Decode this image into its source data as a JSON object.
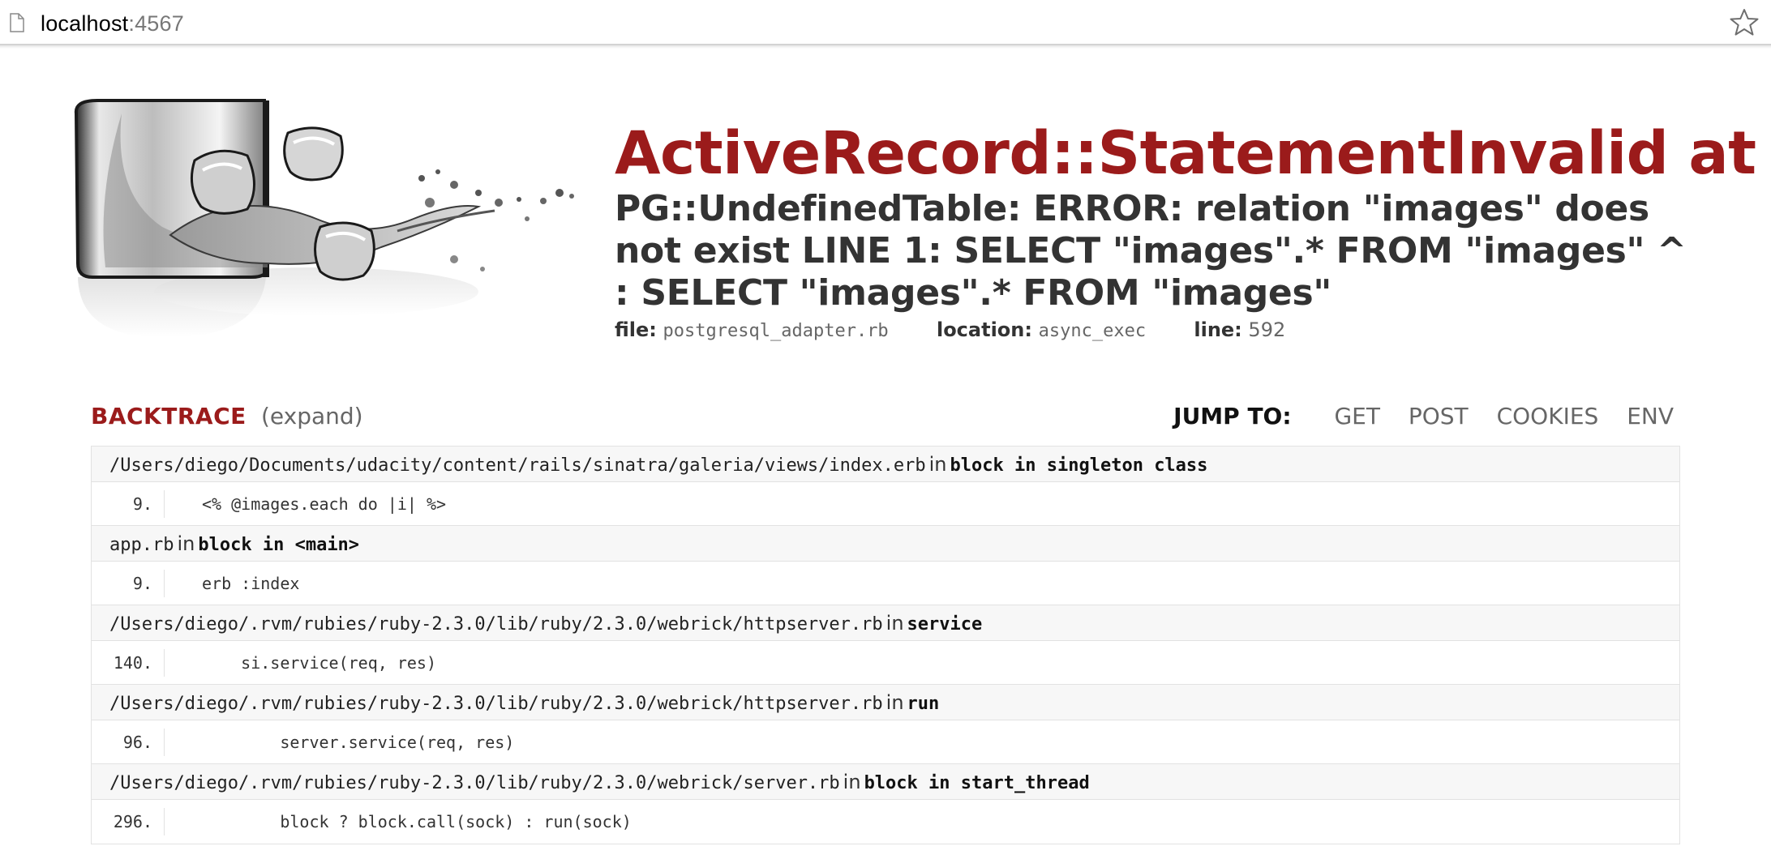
{
  "browser": {
    "url_host": "localhost",
    "url_port": ":4567",
    "page_icon": "page-icon",
    "bookmark_icon": "star-icon"
  },
  "header": {
    "logo": "sinatra-whiskey-glass-logo",
    "title": "ActiveRecord::StatementInvalid at /",
    "message": "PG::UndefinedTable: ERROR: relation \"images\" does not exist LINE 1: SELECT \"images\".* FROM \"images\" ^ : SELECT \"images\".* FROM \"images\"",
    "file_label": "file:",
    "file_value": "postgresql_adapter.rb",
    "location_label": "location:",
    "location_value": "async_exec",
    "line_label": "line:",
    "line_value": "592"
  },
  "backtrace": {
    "title": "BACKTRACE",
    "expand_label": "(expand)",
    "jump_label": "JUMP TO:",
    "jump_links": [
      "GET",
      "POST",
      "COOKIES",
      "ENV"
    ],
    "in_word": "in",
    "frames": [
      {
        "path": "/Users/diego/Documents/udacity/content/rails/sinatra/galeria/views/index.erb",
        "method": "block in singleton class",
        "line": "9.",
        "code": "<% @images.each do |i| %>"
      },
      {
        "path": "app.rb",
        "method": "block in <main>",
        "line": "9.",
        "code": "erb :index"
      },
      {
        "path": "/Users/diego/.rvm/rubies/ruby-2.3.0/lib/ruby/2.3.0/webrick/httpserver.rb",
        "method": "service",
        "line": "140.",
        "code": "    si.service(req, res)"
      },
      {
        "path": "/Users/diego/.rvm/rubies/ruby-2.3.0/lib/ruby/2.3.0/webrick/httpserver.rb",
        "method": "run",
        "line": "96.",
        "code": "        server.service(req, res)"
      },
      {
        "path": "/Users/diego/.rvm/rubies/ruby-2.3.0/lib/ruby/2.3.0/webrick/server.rb",
        "method": "block in start_thread",
        "line": "296.",
        "code": "        block ? block.call(sock) : run(sock)"
      }
    ]
  },
  "colors": {
    "accent_red": "#9b1b1b",
    "text_dark": "#333333",
    "text_muted": "#666666",
    "row_bg": "#f7f7f7",
    "border": "#e2e2e2"
  }
}
